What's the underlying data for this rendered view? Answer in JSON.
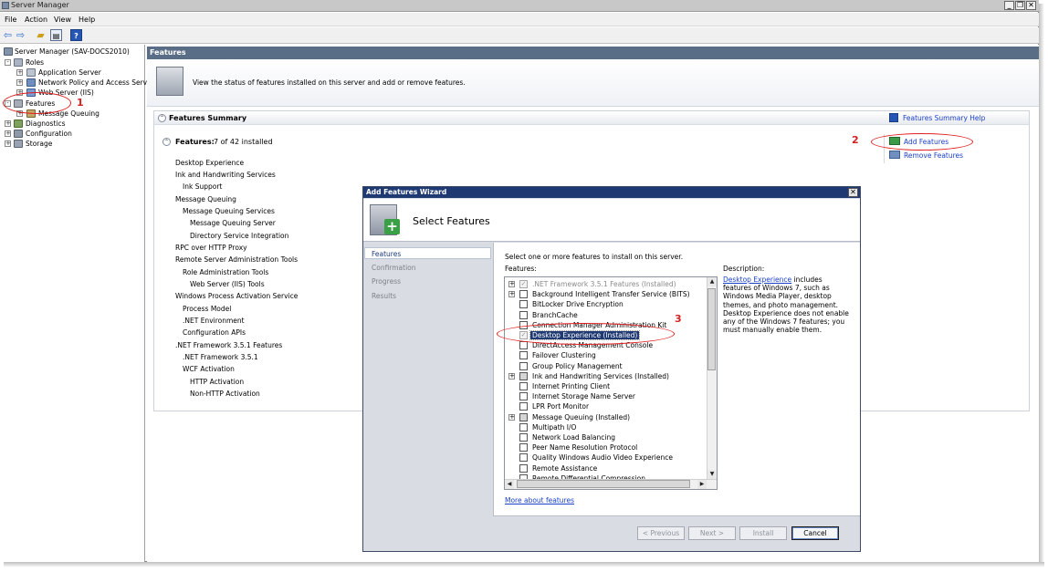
{
  "window": {
    "title": "Server Manager",
    "controls": [
      "_",
      "❐",
      "✕"
    ]
  },
  "menu": [
    "File",
    "Action",
    "View",
    "Help"
  ],
  "toolbar": {
    "icons": [
      "back-arrow-icon",
      "forward-arrow-icon",
      "up-folder-icon",
      "properties-icon",
      "help-icon"
    ]
  },
  "tree": {
    "root": "Server Manager (SAV-DOCS2010)",
    "roles": "Roles",
    "application_server": "Application Server",
    "npas": "Network Policy and Access Services",
    "web_server": "Web Server (IIS)",
    "features": "Features",
    "message_queuing": "Message Queuing",
    "diagnostics": "Diagnostics",
    "configuration": "Configuration",
    "storage": "Storage"
  },
  "pane": {
    "header": "Features",
    "banner_text": "View the status of features installed on this server and add or remove features.",
    "summary_title": "Features Summary",
    "summary_help": "Features Summary Help",
    "features_label": "Features:",
    "features_count": "7 of 42 installed",
    "add_features": "Add Features",
    "remove_features": "Remove Features",
    "installed": [
      "Desktop Experience",
      "Ink and Handwriting Services",
      "Ink Support",
      "Message Queuing",
      "Message Queuing Services",
      "Message Queuing Server",
      "Directory Service Integration",
      "RPC over HTTP Proxy",
      "Remote Server Administration Tools",
      "Role Administration Tools",
      "Web Server (IIS) Tools",
      "Windows Process Activation Service",
      "Process Model",
      ".NET Environment",
      "Configuration APIs",
      ".NET Framework 3.5.1 Features",
      ".NET Framework 3.5.1",
      "WCF Activation",
      "HTTP Activation",
      "Non-HTTP Activation"
    ]
  },
  "dialog": {
    "title": "Add Features Wizard",
    "heading": "Select Features",
    "nav": [
      "Features",
      "Confirmation",
      "Progress",
      "Results"
    ],
    "instruction": "Select one or more features to install on this server.",
    "features_label": "Features:",
    "description_label": "Description:",
    "description_link": "Desktop Experience",
    "description_text": " includes features of Windows 7, such as Windows Media Player, desktop themes, and photo management. Desktop Experience does not enable any of the Windows 7 features; you must manually enable them.",
    "features": [
      {
        "label": ".NET Framework 3.5.1 Features  (Installed)",
        "expand": true,
        "state": "checked-disabled"
      },
      {
        "label": "Background Intelligent Transfer Service (BITS)",
        "expand": true,
        "state": "unchecked"
      },
      {
        "label": "BitLocker Drive Encryption",
        "expand": false,
        "state": "unchecked"
      },
      {
        "label": "BranchCache",
        "expand": false,
        "state": "unchecked"
      },
      {
        "label": "Connection Manager Administration Kit",
        "expand": false,
        "state": "unchecked"
      },
      {
        "label": "Desktop Experience  (Installed)",
        "expand": false,
        "state": "checked-disabled",
        "selected": true
      },
      {
        "label": "DirectAccess Management Console",
        "expand": false,
        "state": "unchecked"
      },
      {
        "label": "Failover Clustering",
        "expand": false,
        "state": "unchecked"
      },
      {
        "label": "Group Policy Management",
        "expand": false,
        "state": "unchecked"
      },
      {
        "label": "Ink and Handwriting Services  (Installed)",
        "expand": true,
        "state": "indeterminate"
      },
      {
        "label": "Internet Printing Client",
        "expand": false,
        "state": "unchecked"
      },
      {
        "label": "Internet Storage Name Server",
        "expand": false,
        "state": "unchecked"
      },
      {
        "label": "LPR Port Monitor",
        "expand": false,
        "state": "unchecked"
      },
      {
        "label": "Message Queuing  (Installed)",
        "expand": true,
        "state": "indeterminate"
      },
      {
        "label": "Multipath I/O",
        "expand": false,
        "state": "unchecked"
      },
      {
        "label": "Network Load Balancing",
        "expand": false,
        "state": "unchecked"
      },
      {
        "label": "Peer Name Resolution Protocol",
        "expand": false,
        "state": "unchecked"
      },
      {
        "label": "Quality Windows Audio Video Experience",
        "expand": false,
        "state": "unchecked"
      },
      {
        "label": "Remote Assistance",
        "expand": false,
        "state": "unchecked"
      },
      {
        "label": "Remote Differential Compression",
        "expand": false,
        "state": "unchecked"
      }
    ],
    "more_link": "More about features",
    "buttons": {
      "previous": "< Previous",
      "next": "Next >",
      "install": "Install",
      "cancel": "Cancel"
    }
  },
  "annotations": {
    "one": "1",
    "two": "2",
    "three": "3",
    "color": "#d62020"
  }
}
